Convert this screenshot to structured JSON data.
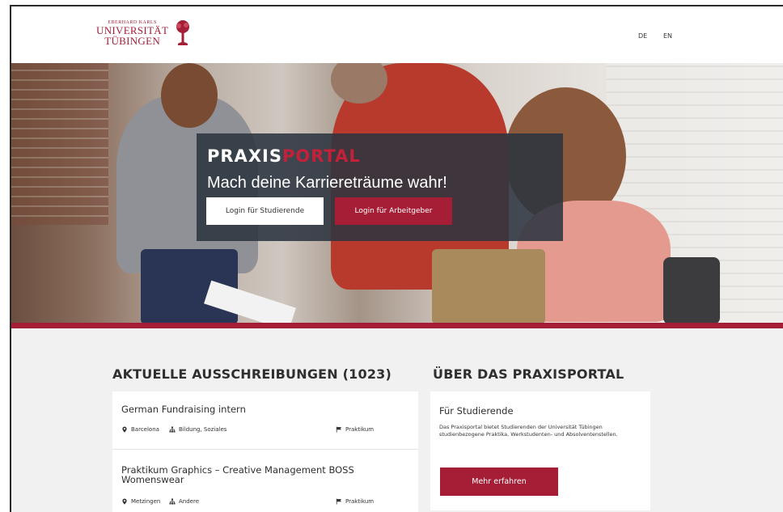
{
  "header": {
    "logo": {
      "line_small": "EBERHARD KARLS",
      "line_1": "UNIVERSITÄT",
      "line_2": "TÜBINGEN"
    },
    "languages": [
      "DE",
      "EN"
    ]
  },
  "hero": {
    "brand_part_1": "PRAXIS",
    "brand_part_2": "PORTAL",
    "title": "Mach deine Karriereträume wahr!",
    "login_students": "Login für Studierende",
    "login_employers": "Login für Arbeitgeber"
  },
  "listings": {
    "heading": "AKTUELLE AUSSCHREIBUNGEN (1023)",
    "items": [
      {
        "title": "German Fundraising intern",
        "location": "Barcelona",
        "category": "Bildung, Soziales",
        "type": "Praktikum"
      },
      {
        "title": "Praktikum Graphics – Creative Management BOSS Womenswear",
        "location": "Metzingen",
        "category": "Andere",
        "type": "Praktikum"
      }
    ]
  },
  "about": {
    "heading": "ÜBER DAS PRAXISPORTAL",
    "card_title": "Für Studierende",
    "card_text": "Das Praxisportal bietet Studierenden der Universität Tübingen studienbezogene Praktika, Werkstudenten- und Absolventenstellen.",
    "button": "Mehr erfahren"
  },
  "colors": {
    "brand_red": "#a51e36",
    "hero_box": "#2c3440",
    "content_bg": "#f1f1f1"
  },
  "icons": {
    "location": "map-pin-icon",
    "category": "sitemap-icon",
    "type": "flag-icon",
    "logo": "tree-icon"
  }
}
